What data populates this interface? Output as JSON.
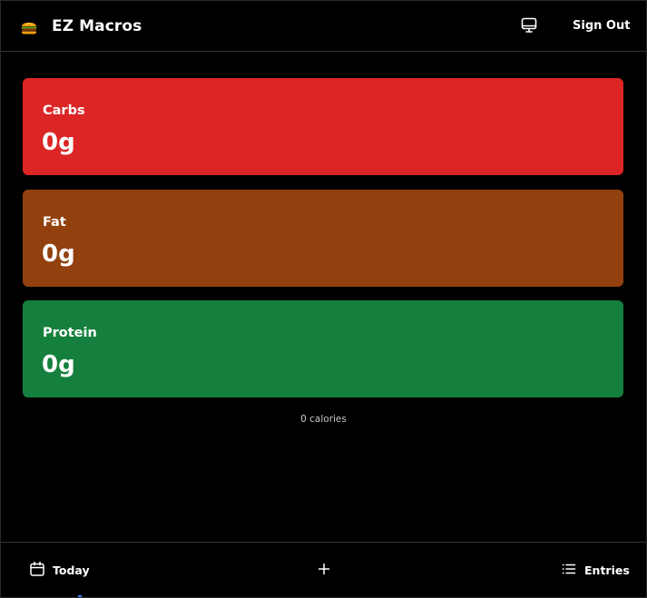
{
  "header": {
    "title": "EZ Macros",
    "logo_icon": "burger-icon",
    "display_icon": "monitor-icon",
    "sign_out_label": "Sign Out"
  },
  "cards": [
    {
      "label": "Carbs",
      "value": "0g",
      "color": "#dc2626"
    },
    {
      "label": "Fat",
      "value": "0g",
      "color": "#92400e"
    },
    {
      "label": "Protein",
      "value": "0g",
      "color": "#15803d"
    }
  ],
  "calories_text": "0 calories",
  "footer": {
    "today_label": "Today",
    "today_icon": "calendar-icon",
    "add_icon": "plus-icon",
    "entries_label": "Entries",
    "entries_icon": "list-icon"
  }
}
